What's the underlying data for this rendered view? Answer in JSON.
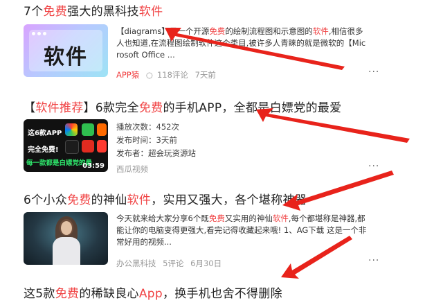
{
  "results": [
    {
      "title": [
        "7个",
        "免费",
        "强大的黑科技",
        "软件"
      ],
      "thumb_text": "软件",
      "snippet": [
        "【diagrams】",
        "是一个开源",
        "免费",
        "的绘制流程图和示意图的",
        "软件",
        ",相信很多",
        "人也知道,在流程图绘制软件这个类目,被许多人青睐的就是微软的【Mic",
        "rosoft Office ..."
      ],
      "meta": {
        "source": "APP猿",
        "comments": "118评论",
        "time": "7天前"
      }
    },
    {
      "title": [
        "【",
        "软件推荐",
        "】6款完全",
        "免费",
        "的手机APP，全都是白嫖党的最爱"
      ],
      "thumb": {
        "line1": "这6款APP",
        "line2": "完全免费!",
        "line3": "每一款都是白嫖党的最",
        "duration": "03:59"
      },
      "info": [
        "播放次数：452次",
        "发布时间：3天前",
        "发布者：超会玩资源站"
      ],
      "meta": {
        "source": "西瓜视频"
      }
    },
    {
      "title": [
        "6个小众",
        "免费",
        "的神仙",
        "软件",
        "，实用又强大，各个堪称神器"
      ],
      "snippet": [
        "今天就来给大家分享6个既",
        "免费",
        "又实用的神仙",
        "软件",
        ",每个都堪称是神器,都",
        "能让你的电脑变得更强大,看完记得收藏起来哦! 1、AG下载 这是一个非",
        "常好用的视频..."
      ],
      "meta": {
        "source": "办公黑科技",
        "comments": "5评论",
        "time": "6月30日"
      }
    },
    {
      "title": [
        "这5款",
        "免费",
        "的稀缺良心",
        "App",
        "，换手机也舍不得删除"
      ]
    }
  ],
  "more_label": "···",
  "colors": {
    "highlight": "#f04142",
    "arrow": "#e8231b"
  }
}
